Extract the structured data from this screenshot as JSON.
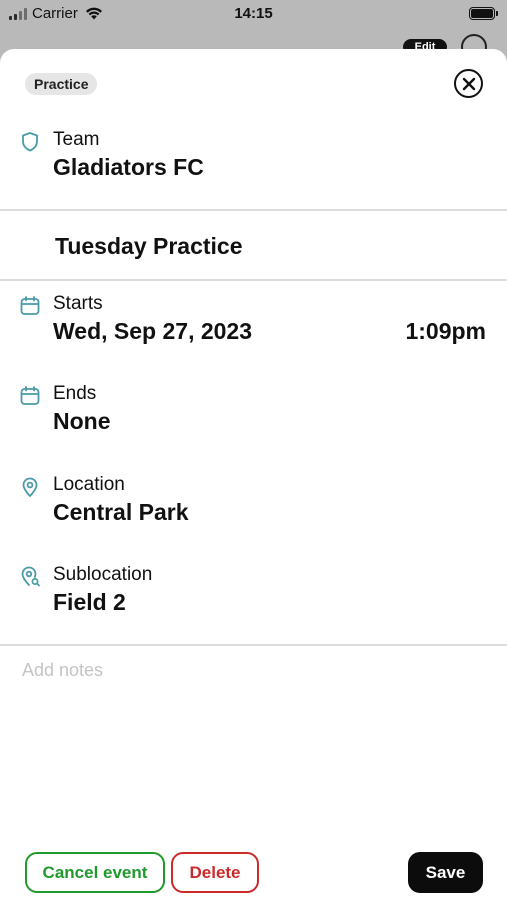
{
  "status_bar": {
    "carrier": "Carrier",
    "time": "14:15"
  },
  "background": {
    "edit_label": "Edit"
  },
  "sheet": {
    "tag": "Practice",
    "team": {
      "label": "Team",
      "value": "Gladiators FC",
      "icon": "shield-icon"
    },
    "event_title": "Tuesday Practice",
    "starts": {
      "label": "Starts",
      "date": "Wed, Sep 27, 2023",
      "time": "1:09pm",
      "icon": "calendar-icon"
    },
    "ends": {
      "label": "Ends",
      "value": "None",
      "icon": "calendar-icon"
    },
    "location": {
      "label": "Location",
      "value": "Central Park",
      "icon": "map-pin-icon"
    },
    "sublocation": {
      "label": "Sublocation",
      "value": "Field 2",
      "icon": "map-pin-search-icon"
    },
    "notes_placeholder": "Add notes"
  },
  "buttons": {
    "cancel_event": "Cancel event",
    "delete": "Delete",
    "save": "Save"
  },
  "colors": {
    "icon_teal": "#4a9aa8",
    "cancel_green": "#1f9a2c",
    "delete_red": "#cc2a2a",
    "save_bg": "#0c0c0c"
  }
}
